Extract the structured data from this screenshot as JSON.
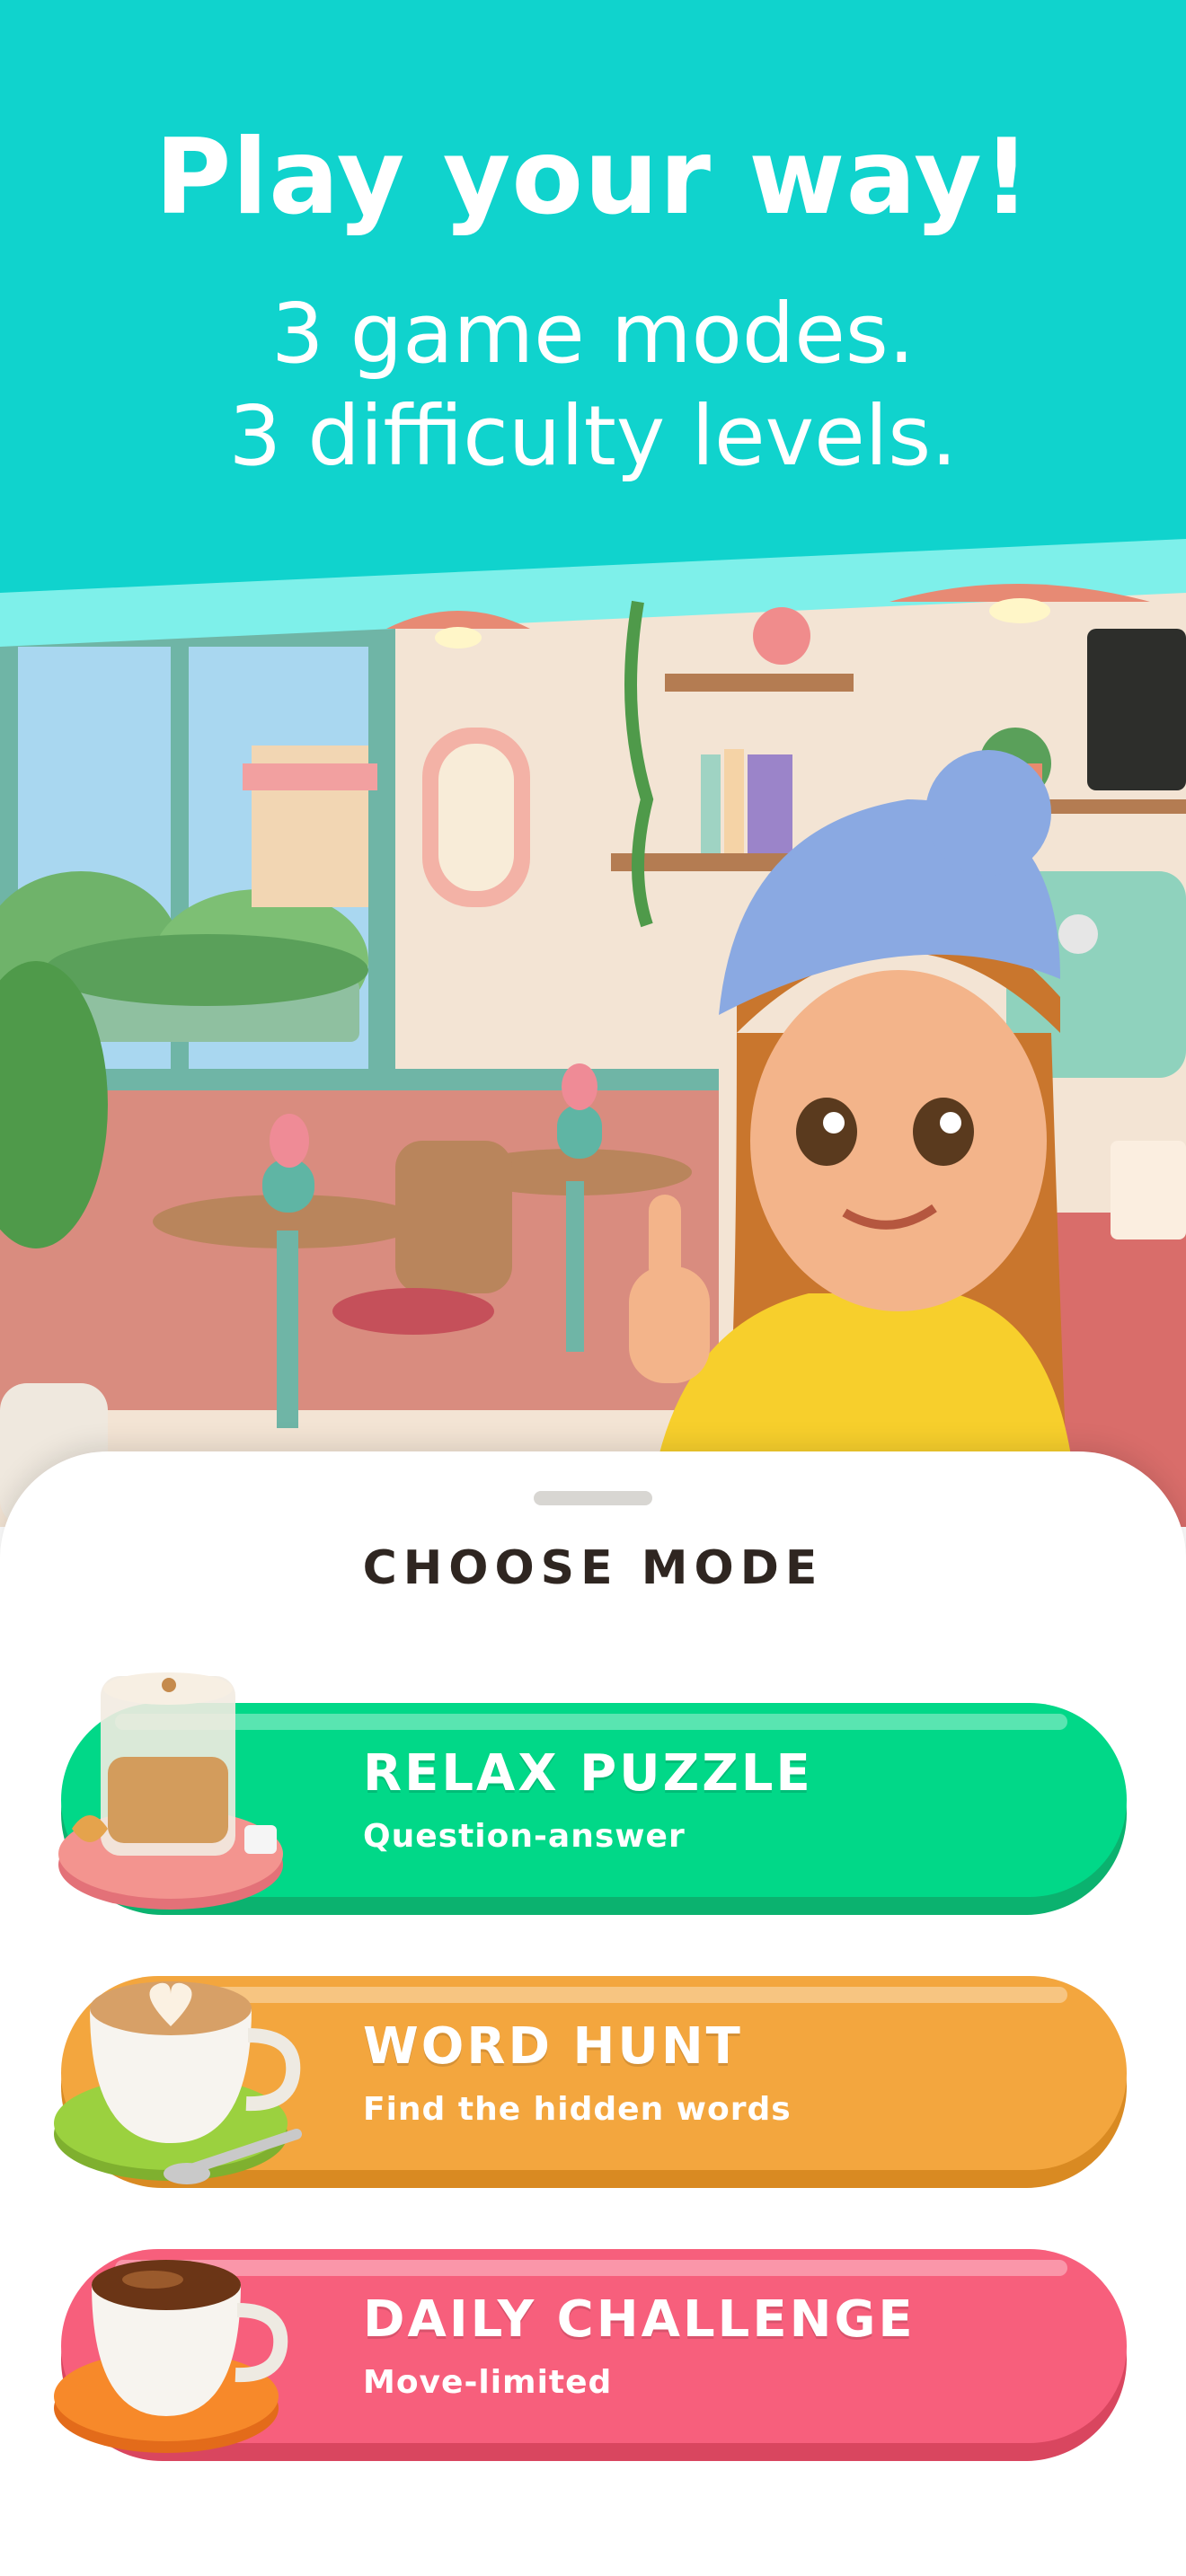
{
  "header": {
    "headline": "Play your way!",
    "subline_1": "3 game modes.",
    "subline_2": "3 difficulty levels."
  },
  "sheet": {
    "title": "CHOOSE MODE",
    "modes": [
      {
        "title": "RELAX PUZZLE",
        "description": "Question-answer",
        "color": "#01d888",
        "shade": "#0bb26f",
        "icon": "latte-glass-icon"
      },
      {
        "title": "WORD HUNT",
        "description": "Find the hidden words",
        "color": "#f3a63e",
        "shade": "#d98a22",
        "icon": "latte-art-cup-icon"
      },
      {
        "title": "DAILY CHALLENGE",
        "description": "Move-limited",
        "color": "#f75f7c",
        "shade": "#d9465f",
        "icon": "espresso-cup-icon"
      }
    ]
  },
  "colors": {
    "header_bg": "#10d3cd",
    "band": "#7ef0ea",
    "title_text": "#2f2621"
  }
}
